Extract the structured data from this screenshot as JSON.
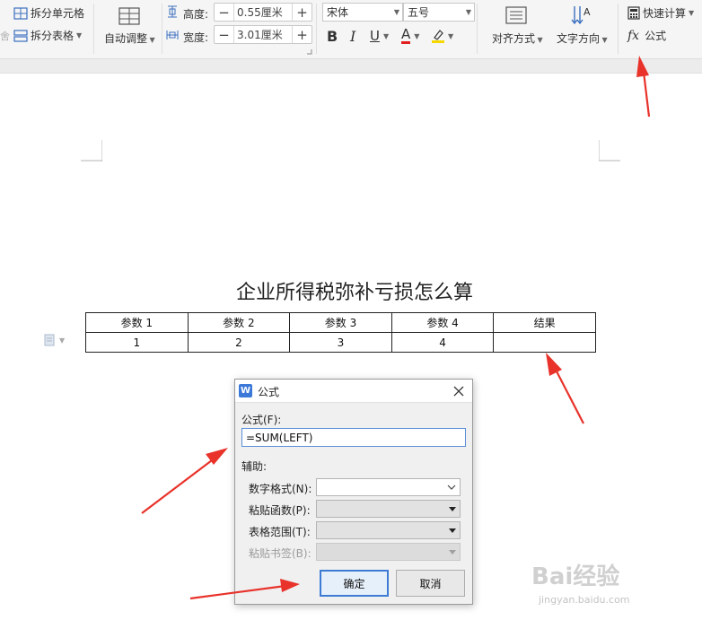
{
  "ribbon": {
    "split_cell": "拆分单元格",
    "split_table": "拆分表格",
    "auto_adjust": "自动调整",
    "height_label": "高度:",
    "height_value": "0.55厘米",
    "width_label": "宽度:",
    "width_value": "3.01厘米",
    "font_name": "宋体",
    "font_size": "五号",
    "bold": "B",
    "italic": "I",
    "underline": "U",
    "font_color": "A",
    "align": "对齐方式",
    "text_direction": "文字方向",
    "quick_calc": "快速计算",
    "formula_fx": "fx",
    "formula": "公式"
  },
  "document": {
    "title": "企业所得税弥补亏损怎么算",
    "table_header": [
      "参数 1",
      "参数 2",
      "参数 3",
      "参数 4",
      "结果"
    ],
    "table_row": [
      "1",
      "2",
      "3",
      "4",
      ""
    ]
  },
  "dialog": {
    "logo": "W",
    "title": "公式",
    "formula_label": "公式(F):",
    "formula_value": "=SUM(LEFT)",
    "aux_label": "辅助:",
    "number_format_label": "数字格式(N):",
    "paste_function_label": "粘贴函数(P):",
    "table_range_label": "表格范围(T):",
    "paste_bookmark_label": "粘贴书签(B):",
    "ok": "确定",
    "cancel": "取消"
  },
  "watermark": {
    "logo": "Bai经验",
    "url": "jingyan.baidu.com"
  },
  "colors": {
    "arrow": "#e8322a",
    "accent": "#3d7bd5",
    "highlight_yellow": "#f5d800",
    "font_color_red": "#e02020"
  },
  "icons": [
    "split-cell-icon",
    "split-table-icon",
    "auto-adjust-icon",
    "height-icon",
    "width-icon",
    "align-icon",
    "text-direction-icon",
    "calculator-icon",
    "close-icon",
    "dropdown-arrow-icon",
    "paragraph-icon"
  ]
}
